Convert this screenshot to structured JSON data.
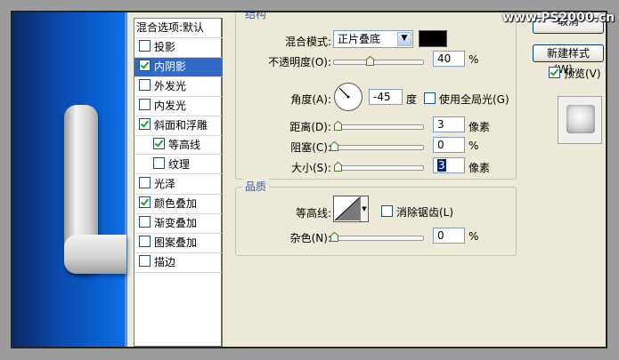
{
  "watermark": "www.PS2000.cn",
  "style_list": {
    "header": "混合选项:默认",
    "items": [
      {
        "label": "投影",
        "checked": false,
        "selected": false,
        "indent": false
      },
      {
        "label": "内阴影",
        "checked": true,
        "selected": true,
        "indent": false
      },
      {
        "label": "外发光",
        "checked": false,
        "selected": false,
        "indent": false
      },
      {
        "label": "内发光",
        "checked": false,
        "selected": false,
        "indent": false
      },
      {
        "label": "斜面和浮雕",
        "checked": true,
        "selected": false,
        "indent": false
      },
      {
        "label": "等高线",
        "checked": true,
        "selected": false,
        "indent": true
      },
      {
        "label": "纹理",
        "checked": false,
        "selected": false,
        "indent": true
      },
      {
        "label": "光泽",
        "checked": false,
        "selected": false,
        "indent": false
      },
      {
        "label": "颜色叠加",
        "checked": true,
        "selected": false,
        "indent": false
      },
      {
        "label": "渐变叠加",
        "checked": false,
        "selected": false,
        "indent": false
      },
      {
        "label": "图案叠加",
        "checked": false,
        "selected": false,
        "indent": false
      },
      {
        "label": "描边",
        "checked": false,
        "selected": false,
        "indent": false
      }
    ]
  },
  "structure": {
    "title": "结构",
    "blend_mode_label": "混合模式:",
    "blend_mode_value": "正片叠底",
    "blend_color": "#000000",
    "opacity_label": "不透明度(O):",
    "opacity_value": "40",
    "opacity_unit": "%",
    "angle_label": "角度(A):",
    "angle_value": "-45",
    "angle_unit": "度",
    "global_light_label": "使用全局光(G)",
    "global_light_checked": false,
    "distance_label": "距离(D):",
    "distance_value": "3",
    "distance_unit": "像素",
    "choke_label": "阻塞(C):",
    "choke_value": "0",
    "choke_unit": "%",
    "size_label": "大小(S):",
    "size_value": "3",
    "size_unit": "像素"
  },
  "quality": {
    "title": "品质",
    "contour_label": "等高线:",
    "antialias_label": "消除锯齿(L)",
    "antialias_checked": false,
    "noise_label": "杂色(N):",
    "noise_value": "0",
    "noise_unit": "%"
  },
  "sidebar": {
    "cancel_label": "取消",
    "new_style_label": "新建样式(W)...",
    "preview_label": "预览(V)",
    "preview_checked": true
  },
  "sliders": {
    "opacity": 0.4,
    "distance": 0.0,
    "choke": 0.0,
    "size": 0.0,
    "noise": 0.0
  }
}
